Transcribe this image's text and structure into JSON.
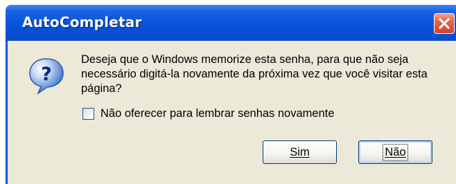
{
  "window": {
    "title": "AutoCompletar"
  },
  "message": {
    "text": "Deseja que o Windows memorize esta senha, para que não seja necessário digitá-la novamente da próxima vez que você visitar esta página?"
  },
  "checkbox": {
    "label": "Não oferecer para lembrar senhas novamente",
    "checked": false
  },
  "buttons": {
    "yes_label": "Sim",
    "no_label": "Não"
  },
  "icons": {
    "title_close": "close-icon",
    "dialog": "question-icon"
  },
  "colors": {
    "titlebar": "#0a56dc",
    "close_button": "#e3664a",
    "body": "#ece9d8"
  }
}
